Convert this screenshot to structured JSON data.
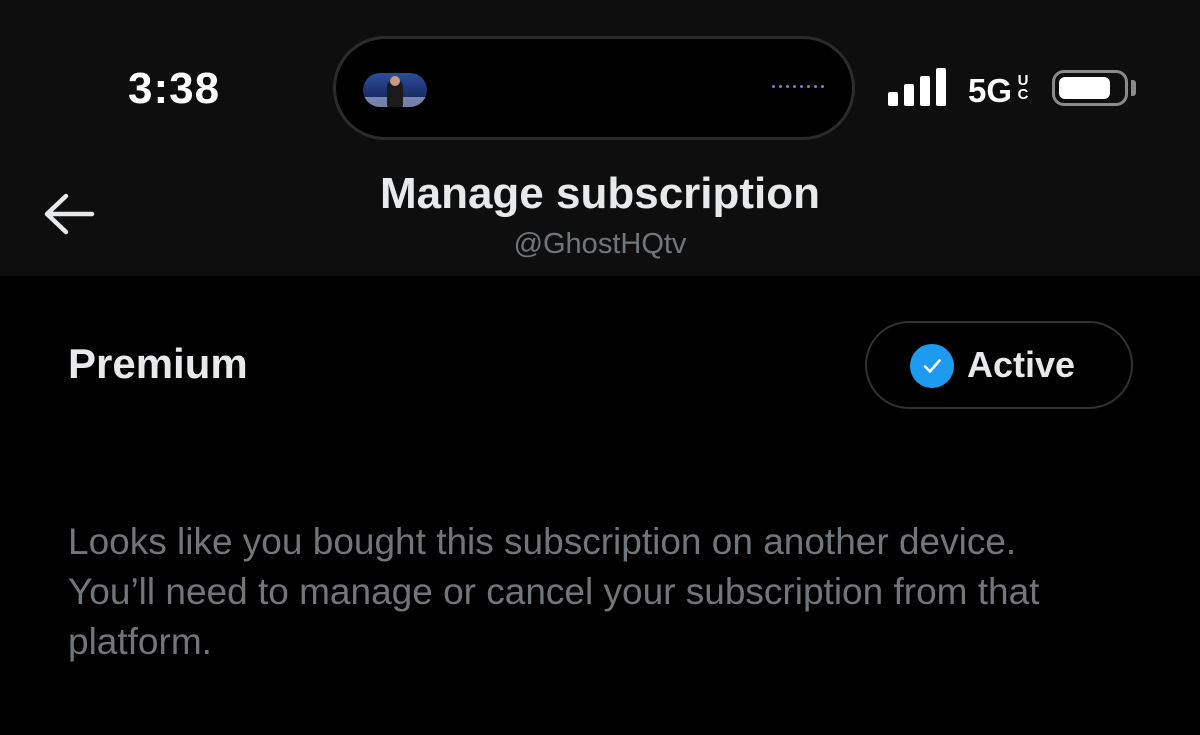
{
  "status_bar": {
    "time": "3:38",
    "network": "5G",
    "network_badge_top": "U",
    "network_badge_bottom": "C",
    "signal_bars": 4,
    "battery_level_fraction": 0.8
  },
  "dynamic_island": {
    "icon": "live-video-thumbnail"
  },
  "header": {
    "back_icon": "arrow-left-icon",
    "title": "Manage subscription",
    "subtitle": "@GhostHQtv"
  },
  "subscription": {
    "plan_name": "Premium",
    "status_label": "Active",
    "status_icon": "check-circle-icon",
    "status_color": "#1d9bf0",
    "notice": "Looks like you bought this subscription on another device. You’ll need to manage or cancel your subscription from that platform."
  }
}
